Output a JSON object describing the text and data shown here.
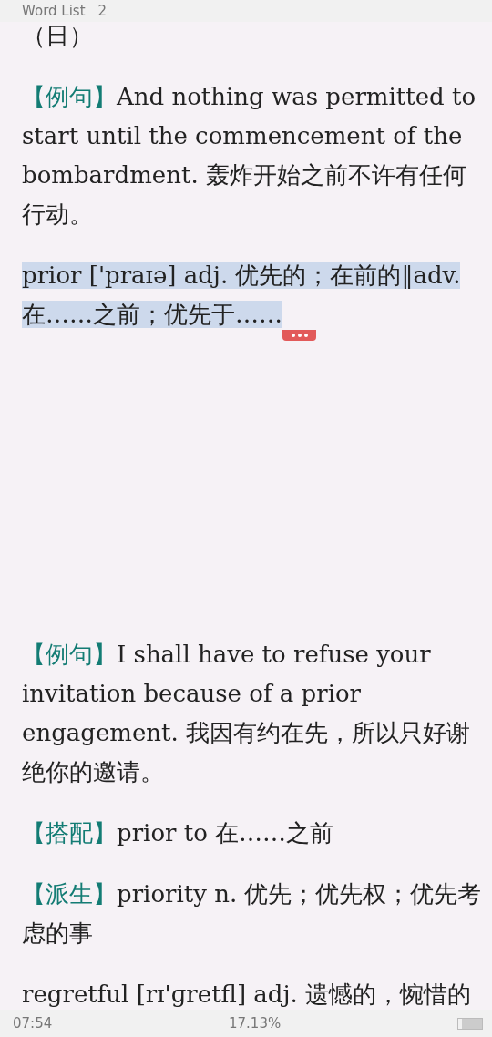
{
  "header": {
    "title": "Word List",
    "page": "2"
  },
  "paragraphs": [
    {
      "text": "（日）",
      "selected": false
    },
    {
      "tag": "【例句】",
      "text": "And nothing was permitted to start until the commencement of the bombardment. 轰炸开始之前不许有任何行动。",
      "selected": false
    },
    {
      "text": "prior ['praɪə] adj. 优先的；在前的‖adv. 在……之前；优先于……",
      "selected": true
    },
    {
      "tag": "【例句】",
      "text": "I shall have to refuse your invitation because of a prior engagement. 我因有约在先，所以只好谢绝你的邀请。",
      "selected": false
    },
    {
      "tag": "【搭配】",
      "text": "prior to 在……之前",
      "selected": false
    },
    {
      "tag": "【派生】",
      "text": "priority n. 优先；优先权；优先考虑的事",
      "selected": false
    },
    {
      "text": "regretful [rɪ'ɡretfl] adj. 遗憾的，惋惜的",
      "selected": false
    }
  ],
  "status_bar": {
    "time": "07:54",
    "progress": "17.13%"
  }
}
